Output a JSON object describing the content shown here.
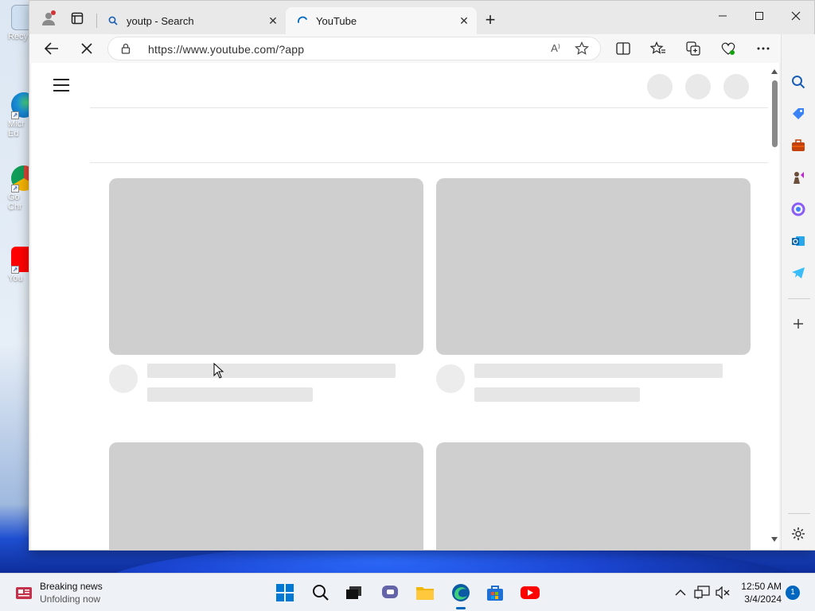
{
  "desktop": {
    "icons": [
      {
        "label": "Recy",
        "icon": "recycle-bin-icon"
      },
      {
        "label": "Micr\nEd",
        "icon": "edge-icon"
      },
      {
        "label": "Go\nChr",
        "icon": "chrome-icon"
      },
      {
        "label": "You",
        "icon": "youtube-icon"
      }
    ]
  },
  "browser": {
    "tabs": [
      {
        "title": "youtp - Search",
        "icon": "search-icon",
        "active": false
      },
      {
        "title": "YouTube",
        "icon": "loading-spinner-icon",
        "active": true
      }
    ],
    "address": {
      "url": "https://www.youtube.com/?app",
      "read_aloud": "A⁾"
    },
    "toolbar_icons": [
      "split-screen-icon",
      "favorites-icon",
      "collections-icon",
      "browser-essentials-icon",
      "more-icon",
      "copilot-icon"
    ],
    "sidebar_icons": [
      "search-icon",
      "shopping-icon",
      "tools-icon",
      "games-icon",
      "office-icon",
      "outlook-icon",
      "telegram-icon",
      "add-icon",
      "settings-icon"
    ]
  },
  "taskbar": {
    "news_title": "Breaking news",
    "news_subtitle": "Unfolding now",
    "apps": [
      "start-icon",
      "search-icon",
      "task-view-icon",
      "chat-icon",
      "file-explorer-icon",
      "edge-icon",
      "store-icon",
      "youtube-icon"
    ],
    "time": "12:50 AM",
    "date": "3/4/2024",
    "notification_count": "1"
  },
  "colors": {
    "accent": "#0067c0",
    "placeholder": "#cfcfcf",
    "youtube_red": "#ff0000"
  }
}
